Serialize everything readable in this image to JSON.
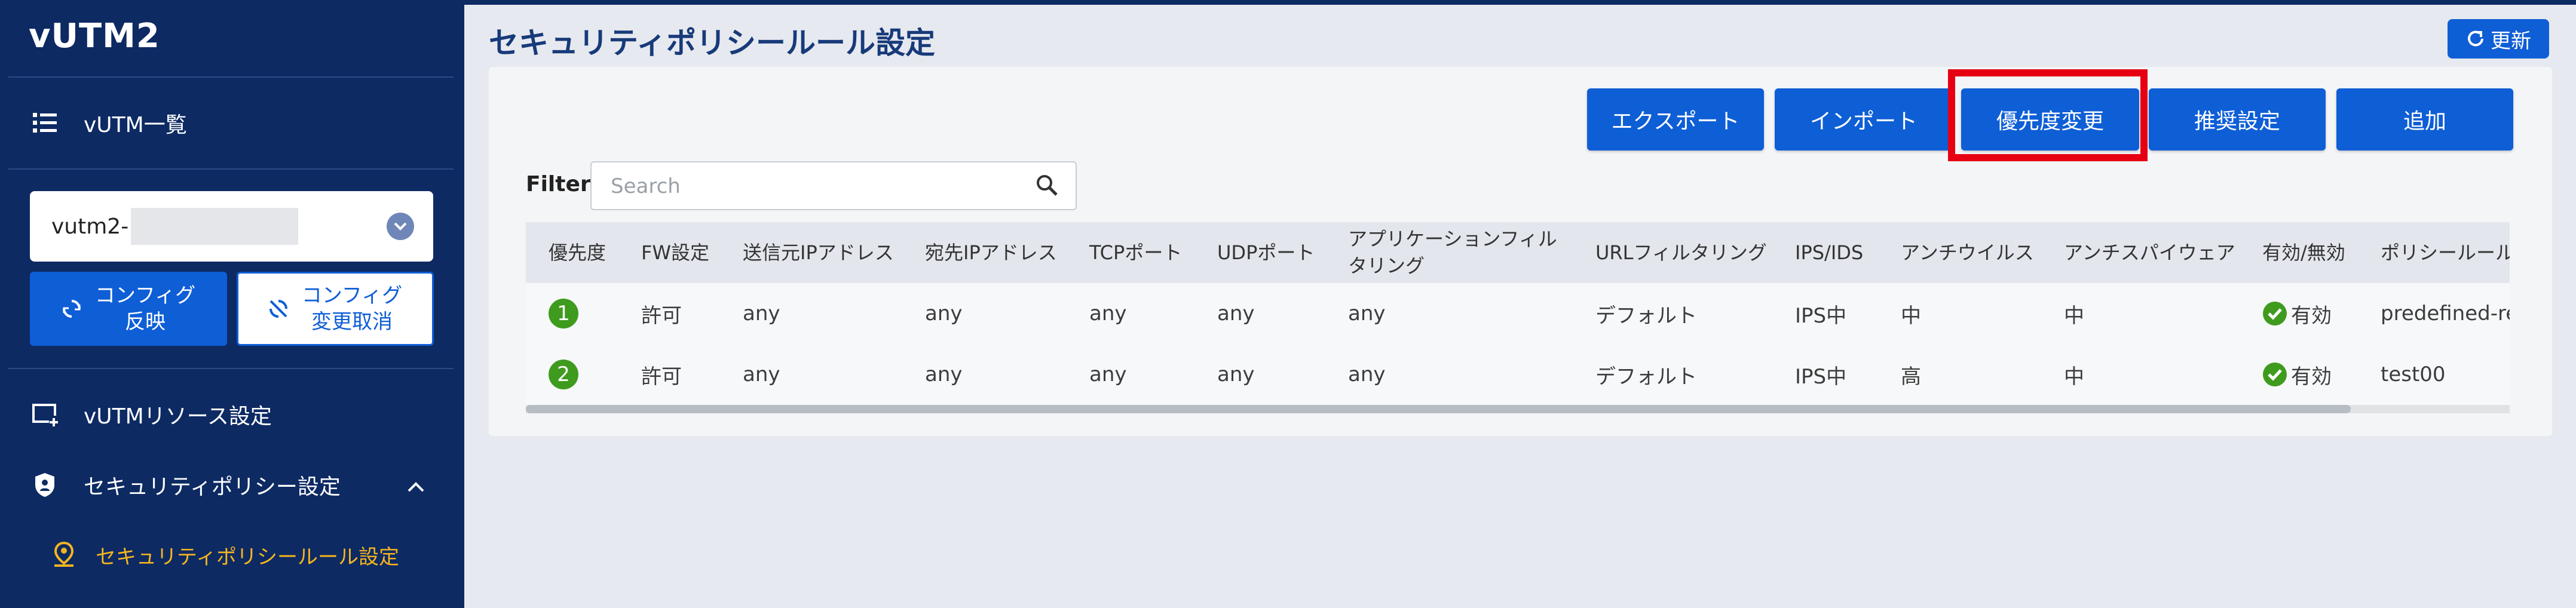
{
  "app": {
    "brand": "vUTM2"
  },
  "sidebar": {
    "vutm_list": "vUTM一覧",
    "device_selector": {
      "value": "vutm2-"
    },
    "apply_button": {
      "line1": "コンフィグ",
      "line2": "反映"
    },
    "cancel_button": {
      "line1": "コンフィグ",
      "line2": "変更取消"
    },
    "resource_settings": "vUTMリソース設定",
    "security_policy": "セキュリティポリシー設定",
    "security_rule": "セキュリティポリシールール設定"
  },
  "header": {
    "title": "セキュリティポリシールール設定",
    "refresh_label": "更新"
  },
  "toolbar": {
    "export": "エクスポート",
    "import": "インポート",
    "priority_change": "優先度変更",
    "recommended": "推奨設定",
    "add": "追加"
  },
  "filter": {
    "label": "Filter",
    "placeholder": "Search"
  },
  "table": {
    "columns": [
      {
        "line1": "優先度",
        "line2": ""
      },
      {
        "line1": "FW設定",
        "line2": ""
      },
      {
        "line1": "送信元IPアドレス",
        "line2": ""
      },
      {
        "line1": "宛先IPアドレス",
        "line2": ""
      },
      {
        "line1": "TCPポート",
        "line2": ""
      },
      {
        "line1": "UDPポート",
        "line2": ""
      },
      {
        "line1": "アプリケーションフィル",
        "line2": "タリング"
      },
      {
        "line1": "URLフィルタリング",
        "line2": ""
      },
      {
        "line1": "IPS/IDS",
        "line2": ""
      },
      {
        "line1": "アンチウイルス",
        "line2": ""
      },
      {
        "line1": "アンチスパイウェア",
        "line2": ""
      },
      {
        "line1": "有効/無効",
        "line2": ""
      },
      {
        "line1": "ポリシールール名",
        "line2": ""
      }
    ],
    "rows": [
      {
        "priority": "1",
        "fw": "許可",
        "src": "any",
        "dst": "any",
        "tcp": "any",
        "udp": "any",
        "app": "any",
        "url": "デフォルト",
        "ips": "IPS中",
        "av": "中",
        "as": "中",
        "enabled": "有効",
        "name": "predefined-re"
      },
      {
        "priority": "2",
        "fw": "許可",
        "src": "any",
        "dst": "any",
        "tcp": "any",
        "udp": "any",
        "app": "any",
        "url": "デフォルト",
        "ips": "IPS中",
        "av": "高",
        "as": "中",
        "enabled": "有効",
        "name": "test00"
      }
    ],
    "scroll_fraction": 0.92
  },
  "colors": {
    "sidebar_bg": "#0d2a63",
    "accent": "#0e5ed6",
    "active_nav": "#f5b51f",
    "highlight": "#e60012",
    "priority_badge": "#3f9b1e"
  },
  "icons": {
    "list": "list-icon",
    "chevron": "chevron-down-icon",
    "sync": "sync-icon",
    "sync_off": "sync-off-icon",
    "resource": "add-box-icon",
    "shield": "shield-icon",
    "expand": "chevron-up-icon",
    "rule": "location-icon",
    "refresh": "refresh-icon",
    "search": "search-icon",
    "check": "check-circle-icon"
  }
}
